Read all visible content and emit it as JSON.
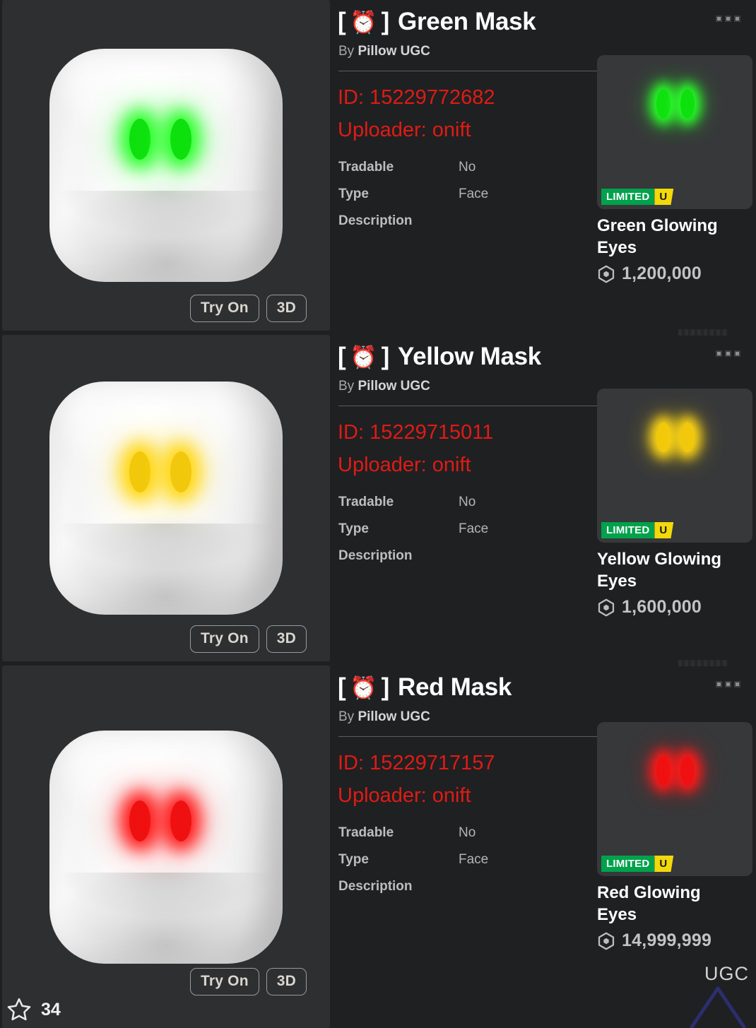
{
  "app": {
    "background_color": "#1f2022",
    "accent_red": "#e01b14",
    "limited_green": "#00a24b",
    "limited_yellow": "#f3d90a"
  },
  "labels": {
    "by_prefix": "By",
    "tradable_key": "Tradable",
    "type_key": "Type",
    "description_key": "Description",
    "try_on": "Try On",
    "three_d": "3D",
    "overflow_menu": "overflow-menu",
    "clock_emoji": "⏰"
  },
  "footer": {
    "favorite_count": "34",
    "watermark": "UGC"
  },
  "items": [
    {
      "title_brackets_open": "[",
      "title_brackets_close": "]",
      "name": "Green Mask",
      "creator": "Pillow UGC",
      "id_line": "ID: 15229772682",
      "uploader_line": "Uploader: onift",
      "tradable_value": "No",
      "type_value": "Face",
      "eye_color": "#0ee00e",
      "eye_glow": "#2bff2b",
      "card": {
        "badge_limited": "LIMITED",
        "badge_u": "U",
        "name": "Green Glowing Eyes",
        "price": "1,200,000"
      }
    },
    {
      "title_brackets_open": "[",
      "title_brackets_close": "]",
      "name": "Yellow Mask",
      "creator": "Pillow UGC",
      "id_line": "ID: 15229715011",
      "uploader_line": "Uploader: onift",
      "tradable_value": "No",
      "type_value": "Face",
      "eye_color": "#f2c80c",
      "eye_glow": "#ffd715",
      "card": {
        "badge_limited": "LIMITED",
        "badge_u": "U",
        "name": "Yellow Glowing Eyes",
        "price": "1,600,000"
      }
    },
    {
      "title_brackets_open": "[",
      "title_brackets_close": "]",
      "name": "Red Mask",
      "creator": "Pillow UGC",
      "id_line": "ID: 15229717157",
      "uploader_line": "Uploader: onift",
      "tradable_value": "No",
      "type_value": "Face",
      "eye_color": "#ef1111",
      "eye_glow": "#ff1a1a",
      "card": {
        "badge_limited": "LIMITED",
        "badge_u": "U",
        "name": "Red Glowing Eyes",
        "price": "14,999,999"
      }
    }
  ]
}
